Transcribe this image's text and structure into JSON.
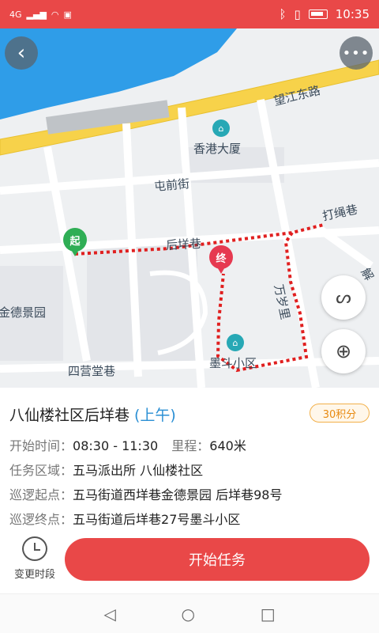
{
  "status_bar": {
    "network": "4G",
    "time": "10:35"
  },
  "map": {
    "roads": {
      "wangjiang": "望江东路",
      "tunqian": "屯前街",
      "houyang": "后垟巷",
      "dasheng": "打绳巷",
      "sijingtang": "四营堂巷",
      "wansui": "万岁里",
      "jie": "解"
    },
    "places": {
      "hongkong": "香港大厦",
      "jinde": "金德景园",
      "modou": "墨斗小区"
    },
    "markers": {
      "start": "起",
      "end": "终"
    }
  },
  "task": {
    "title": "八仙楼社区后垟巷",
    "period": "(上午)",
    "points": "30积分",
    "start_time_key": "开始时间：",
    "start_time_val": "08:30 - 11:30",
    "mileage_key": "里程：",
    "mileage_val": "640米",
    "area_key": "任务区域：",
    "area_val": "五马派出所 八仙楼社区",
    "start_point_key": "巡逻起点：",
    "start_point_val": "五马街道西垟巷金德景园 后垟巷98号",
    "end_point_key": "巡逻终点：",
    "end_point_val": "五马街道后垟巷27号墨斗小区"
  },
  "actions": {
    "change_period": "变更时段",
    "start_task": "开始任务"
  },
  "colors": {
    "brand_red": "#e94848",
    "accent_blue": "#2a8fd4",
    "points_orange": "#e88a10",
    "water": "#2f9de8",
    "highway": "#f7d24a"
  }
}
